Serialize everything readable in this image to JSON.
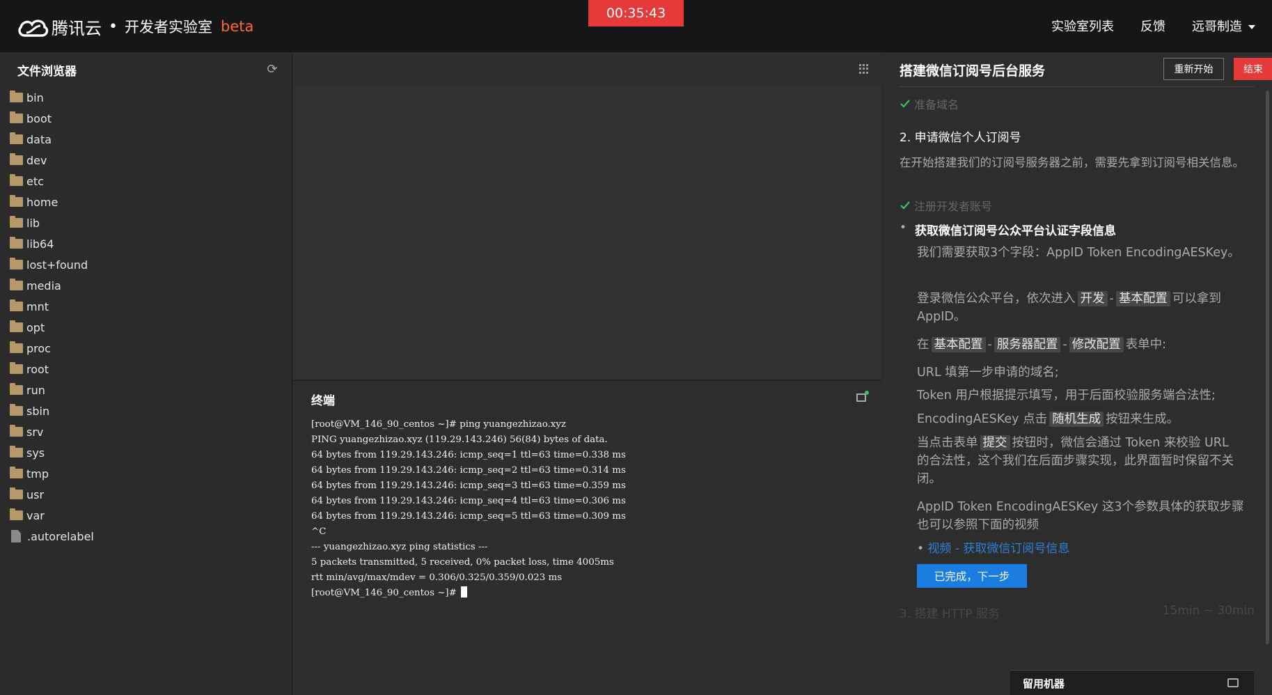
{
  "header": {
    "brand": "腾讯云",
    "separator": "•",
    "product": "开发者实验室",
    "beta": "beta",
    "timer": "00:35:43",
    "nav": [
      "实验室列表",
      "反馈",
      "远哥制造"
    ]
  },
  "file_browser": {
    "title": "文件浏览器",
    "items": [
      {
        "name": "bin",
        "type": "folder"
      },
      {
        "name": "boot",
        "type": "folder"
      },
      {
        "name": "data",
        "type": "folder"
      },
      {
        "name": "dev",
        "type": "folder"
      },
      {
        "name": "etc",
        "type": "folder"
      },
      {
        "name": "home",
        "type": "folder"
      },
      {
        "name": "lib",
        "type": "folder"
      },
      {
        "name": "lib64",
        "type": "folder"
      },
      {
        "name": "lost+found",
        "type": "folder"
      },
      {
        "name": "media",
        "type": "folder"
      },
      {
        "name": "mnt",
        "type": "folder"
      },
      {
        "name": "opt",
        "type": "folder"
      },
      {
        "name": "proc",
        "type": "folder"
      },
      {
        "name": "root",
        "type": "folder"
      },
      {
        "name": "run",
        "type": "folder"
      },
      {
        "name": "sbin",
        "type": "folder"
      },
      {
        "name": "srv",
        "type": "folder"
      },
      {
        "name": "sys",
        "type": "folder"
      },
      {
        "name": "tmp",
        "type": "folder"
      },
      {
        "name": "usr",
        "type": "folder"
      },
      {
        "name": "var",
        "type": "folder"
      },
      {
        "name": ".autorelabel",
        "type": "file"
      }
    ]
  },
  "terminal": {
    "title": "终端",
    "lines": [
      "[root@VM_146_90_centos ~]# ping yuangezhizao.xyz",
      "PING yuangezhizao.xyz (119.29.143.246) 56(84) bytes of data.",
      "64 bytes from 119.29.143.246: icmp_seq=1 ttl=63 time=0.338 ms",
      "64 bytes from 119.29.143.246: icmp_seq=2 ttl=63 time=0.314 ms",
      "64 bytes from 119.29.143.246: icmp_seq=3 ttl=63 time=0.359 ms",
      "64 bytes from 119.29.143.246: icmp_seq=4 ttl=63 time=0.306 ms",
      "64 bytes from 119.29.143.246: icmp_seq=5 ttl=63 time=0.309 ms",
      "^C",
      "--- yuangezhizao.xyz ping statistics ---",
      "5 packets transmitted, 5 received, 0% packet loss, time 4005ms",
      "rtt min/avg/max/mdev = 0.306/0.325/0.359/0.023 ms"
    ],
    "prompt": "[root@VM_146_90_centos ~]# "
  },
  "lab": {
    "title": "搭建微信订阅号后台服务",
    "restart": "重新开始",
    "end": "结束",
    "done1": "准备域名",
    "step2": "2. 申请微信个人订阅号",
    "intro": "在开始搭建我们的订阅号服务器之前，需要先拿到订阅号相关信息。",
    "done2": "注册开发者账号",
    "current": "获取微信订阅号公众平台认证字段信息",
    "p1": "我们需要获取3个字段：AppID Token EncodingAESKey。",
    "p2a": "登录微信公众平台，依次进入",
    "tag_dev": "开发",
    "dash": "-",
    "tag_basic": "基本配置",
    "p2b": "可以拿到 AppID。",
    "p3a": "在",
    "tag_server": "服务器配置",
    "tag_modify": "修改配置",
    "p3b": "表单中:",
    "p4": "URL 填第一步申请的域名;",
    "p5": "Token 用户根据提示填写，用于后面校验服务端合法性;",
    "p6a": "EncodingAESKey 点击",
    "tag_random": "随机生成",
    "p6b": "按钮来生成。",
    "p7a": "当点击表单",
    "tag_submit": "提交",
    "p7b": "按钮时，微信会通过 Token 来校验 URL 的合法性，这个我们在后面步骤实现，此界面暂时保留不关闭。",
    "p8": "AppID Token EncodingAESKey 这3个参数具体的获取步骤也可以参照下面的视频",
    "link": "视频 - 获取微信订阅号信息",
    "next": "已完成，下一步",
    "step3": "3. 搭建 HTTP 服务",
    "step3_time": "15min ~ 30min",
    "keep": "留用机器"
  },
  "colors": {
    "accent": "#1b7de0",
    "danger": "#e5393a",
    "beta": "#ff6a2a",
    "link": "#2d82d5",
    "success": "#3cc35e"
  }
}
